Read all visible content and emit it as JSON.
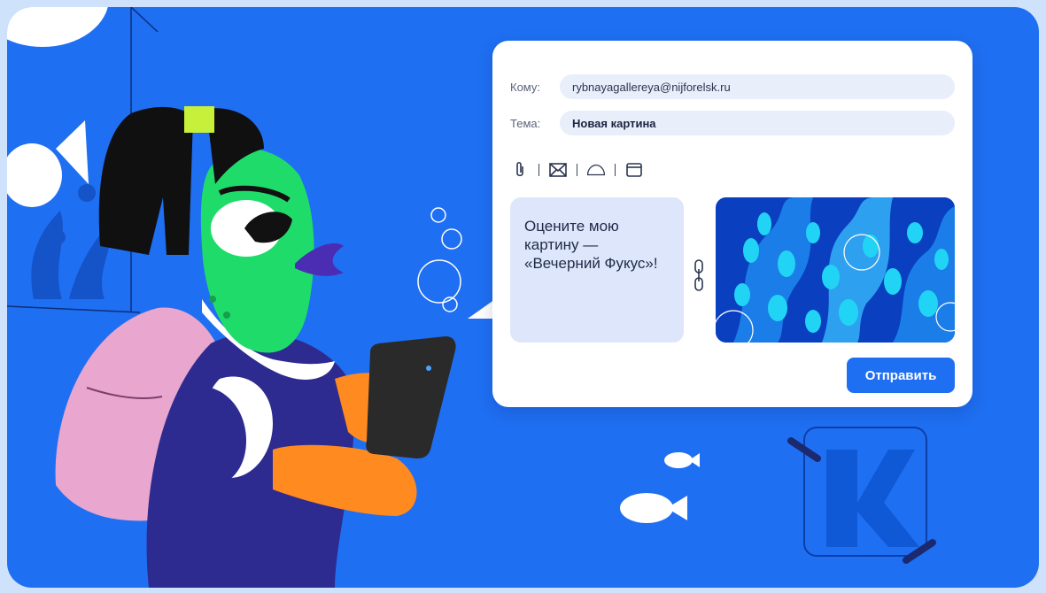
{
  "email": {
    "to_label": "Кому:",
    "to_value": "rybnayagallereya@nijforelsk.ru",
    "subject_label": "Тема:",
    "subject_value": "Новая картина",
    "toolbar_icons": [
      "paperclip-icon",
      "envelope-icon",
      "cloud-icon",
      "window-icon"
    ],
    "message_text": "Оцените мою картину — «Вечерний Фукус»!",
    "send_label": "Отправить"
  },
  "colors": {
    "background_blue": "#1f6ff2",
    "card_white": "#ffffff",
    "field_fill": "#e8eefa",
    "message_fill": "#dde6fb",
    "send_button": "#1f6ff2"
  }
}
